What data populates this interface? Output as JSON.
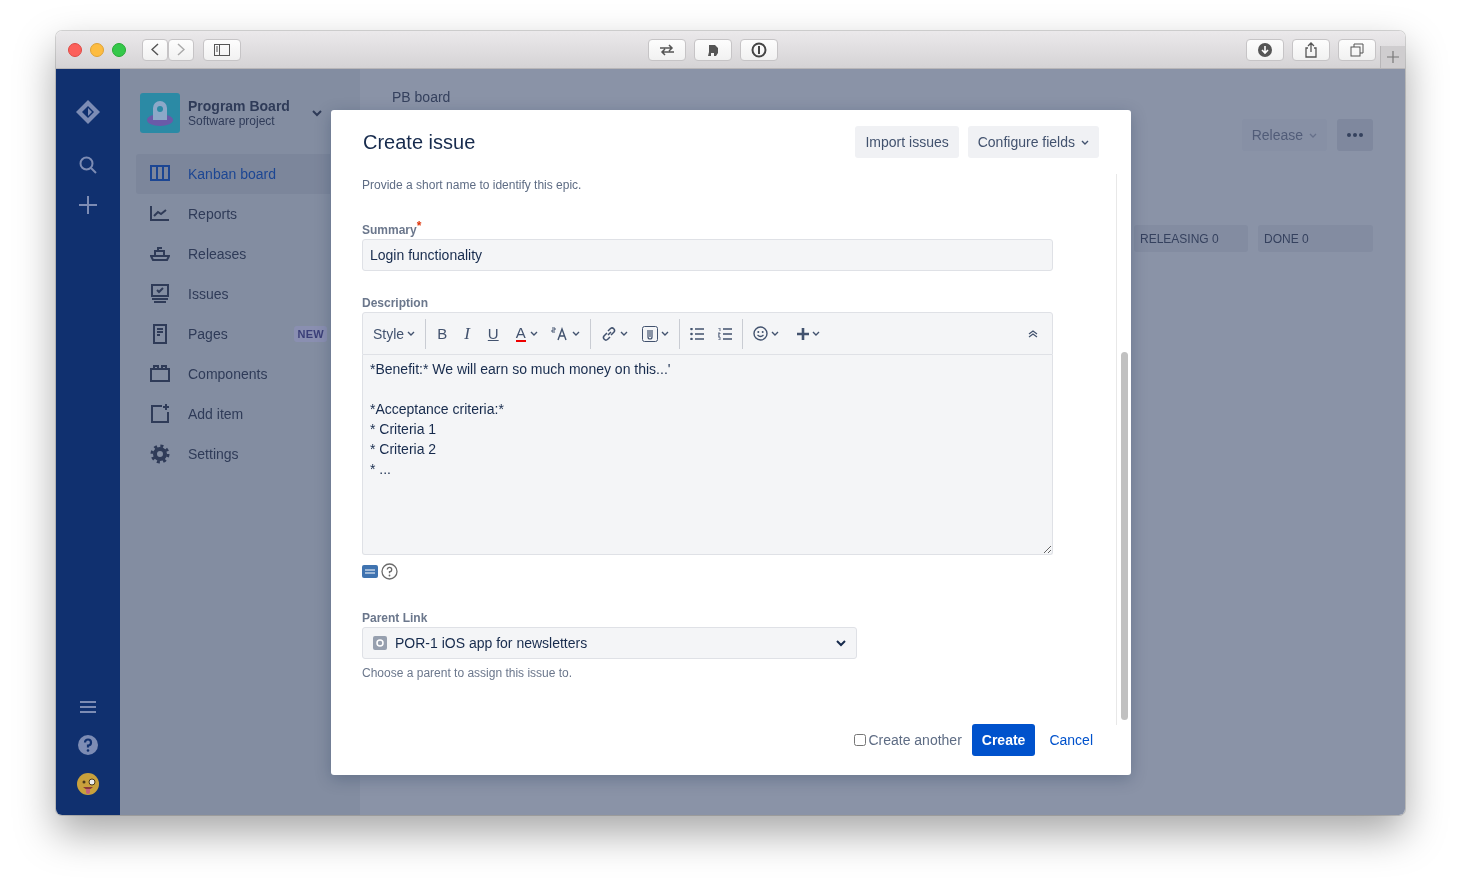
{
  "project": {
    "name": "Program Board",
    "type": "Software project"
  },
  "sidebar": {
    "items": [
      {
        "label": "Kanban board",
        "selected": true
      },
      {
        "label": "Reports",
        "selected": false
      },
      {
        "label": "Releases",
        "selected": false
      },
      {
        "label": "Issues",
        "selected": false
      },
      {
        "label": "Pages",
        "selected": false,
        "badge": "NEW"
      },
      {
        "label": "Components",
        "selected": false
      },
      {
        "label": "Add item",
        "selected": false
      },
      {
        "label": "Settings",
        "selected": false
      }
    ]
  },
  "board": {
    "title": "PB board",
    "release_button": "Release",
    "columns": [
      {
        "header": "RELEASING 0"
      },
      {
        "header": "DONE 0"
      }
    ]
  },
  "dialog": {
    "title": "Create issue",
    "header_buttons": [
      "Import issues",
      "Configure fields"
    ],
    "intro": "Provide a short name to identify this epic.",
    "summary": {
      "label": "Summary",
      "required_mark": "*",
      "value": "Login functionality"
    },
    "description": {
      "label": "Description",
      "toolbar": {
        "style": "Style",
        "bold": "B",
        "italic": "I",
        "underline": "U",
        "text_color": "A"
      },
      "value": "*Benefit:* We will earn so much money on this...'\n\n*Acceptance criteria:*\n* Criteria 1\n* Criteria 2\n* ..."
    },
    "parent_link": {
      "label": "Parent Link",
      "value": "POR-1 iOS app for newsletters",
      "help": "Choose a parent to assign this issue to."
    },
    "create_another": {
      "label": "Create another",
      "checked": false
    },
    "create_button": "Create",
    "cancel_button": "Cancel"
  }
}
